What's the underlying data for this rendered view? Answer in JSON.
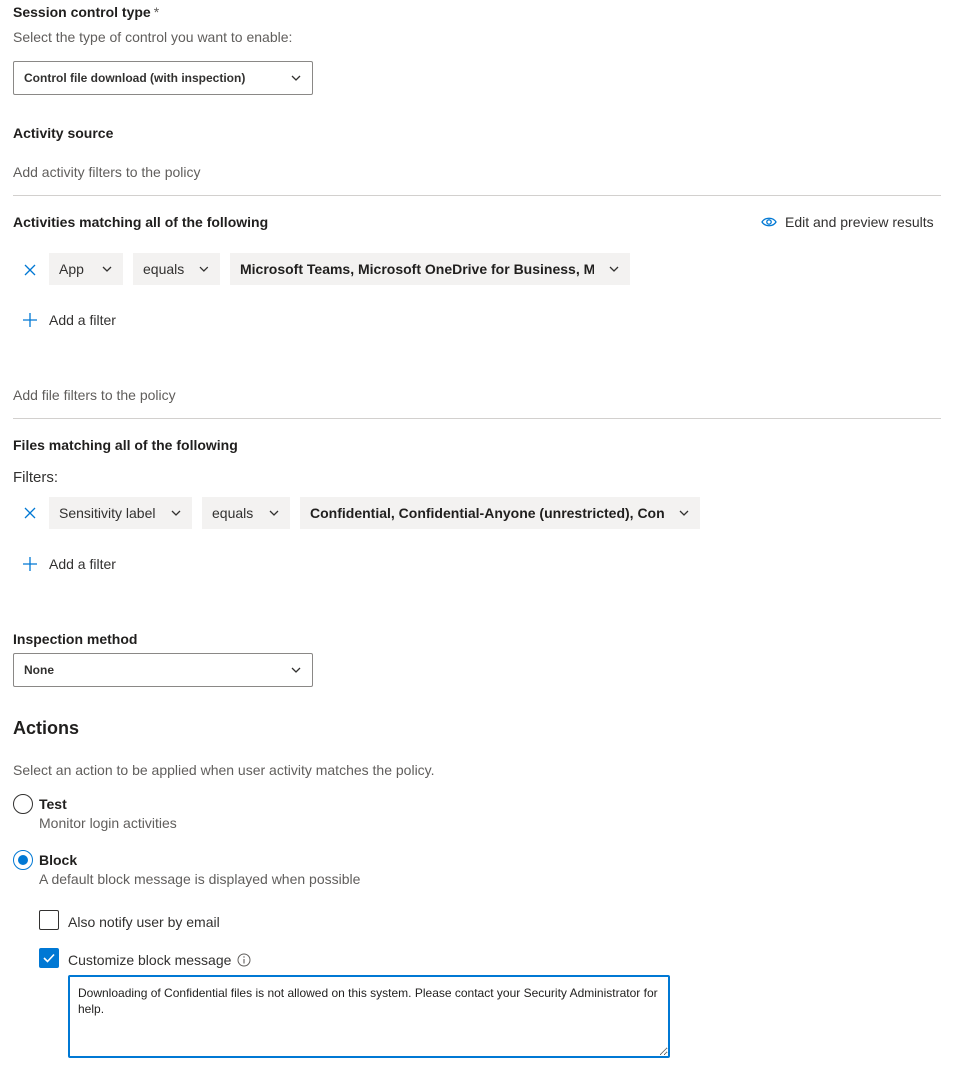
{
  "session_control": {
    "label": "Session control type",
    "required_mark": "*",
    "description": "Select the type of control you want to enable:",
    "selected": "Control file download (with inspection)"
  },
  "activity_source": {
    "label": "Activity source",
    "description": "Add activity filters to the policy",
    "match_label": "Activities matching all of the following",
    "preview_link": "Edit and preview results",
    "filter": {
      "field": "App",
      "operator": "equals",
      "value": "Microsoft Teams, Microsoft OneDrive for Business, Mi..."
    },
    "add_filter": "Add a filter"
  },
  "file_filters": {
    "description": "Add file filters to the policy",
    "match_label": "Files matching all of the following",
    "filters_label": "Filters:",
    "filter": {
      "field": "Sensitivity label",
      "operator": "equals",
      "value": "Confidential, Confidential-Anyone (unrestricted), Con..."
    },
    "add_filter": "Add a filter"
  },
  "inspection": {
    "label": "Inspection method",
    "selected": "None"
  },
  "actions": {
    "heading": "Actions",
    "description": "Select an action to be applied when user activity matches the policy.",
    "options": [
      {
        "title": "Test",
        "desc": "Monitor login activities",
        "checked": false
      },
      {
        "title": "Block",
        "desc": "A default block message is displayed when possible",
        "checked": true
      }
    ],
    "notify_email": {
      "label": "Also notify user by email",
      "checked": false
    },
    "customize_message": {
      "label": "Customize block message",
      "checked": true
    },
    "block_message": "Downloading of Confidential files is not allowed on this system. Please contact your Security Administrator for help."
  },
  "colors": {
    "accent": "#0078d4",
    "chip_bg": "#f3f2f1",
    "divider": "#d2d0ce"
  }
}
